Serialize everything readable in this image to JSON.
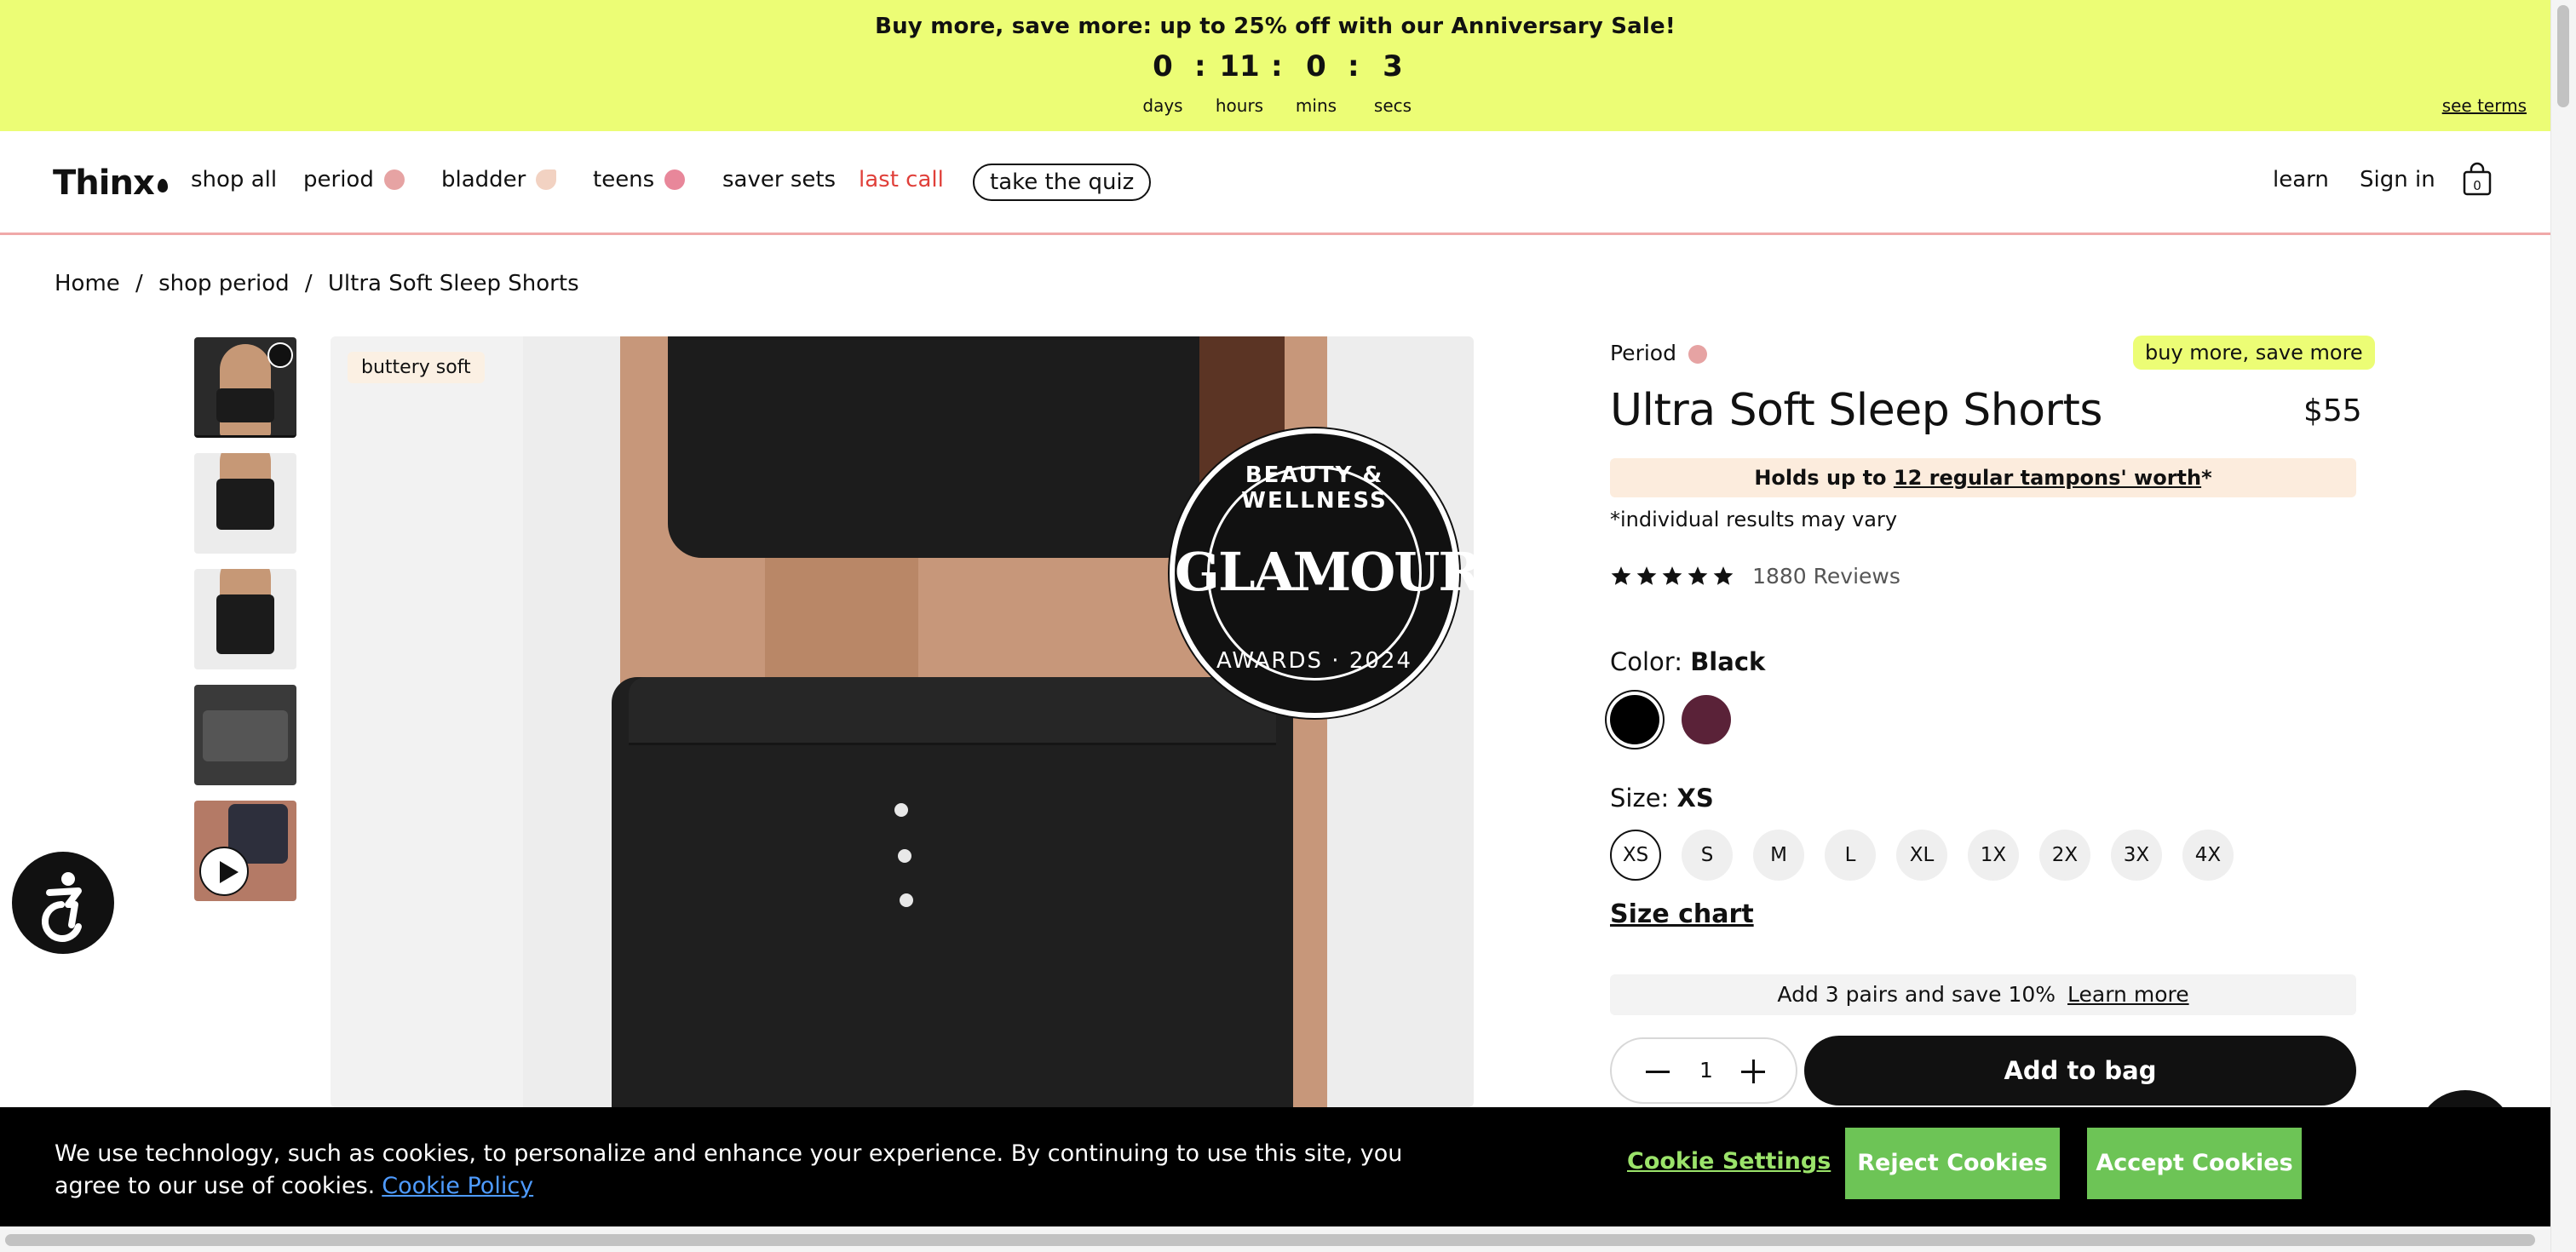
{
  "promo": {
    "text": "Buy more, save more: up to 25% off with our  Anniversary Sale!",
    "countdown": [
      {
        "value": "0",
        "label": "days"
      },
      {
        "value": "11",
        "label": "hours"
      },
      {
        "value": "0",
        "label": "mins"
      },
      {
        "value": "3",
        "label": "secs"
      }
    ],
    "separator": ":",
    "see_terms": "see terms"
  },
  "header": {
    "logo": "Thinx",
    "nav": [
      {
        "label": "shop all"
      },
      {
        "label": "period",
        "dot_color": "#e6a3a3"
      },
      {
        "label": "bladder",
        "dot_color": "#f2d2c2"
      },
      {
        "label": "teens",
        "dot_color": "#e8879a"
      },
      {
        "label": "saver sets"
      },
      {
        "label": "last call",
        "color": "#e0403a"
      }
    ],
    "quiz": "take the quiz",
    "learn": "learn",
    "sign_in": "Sign in",
    "cart_count": "0"
  },
  "breadcrumb": [
    "Home",
    "/",
    "shop period",
    "/",
    "Ultra Soft Sleep Shorts"
  ],
  "gallery": {
    "tag": "buttery soft",
    "badge": {
      "top": "BEAUTY & WELLNESS",
      "main": "GLAMOUR",
      "bottom": "AWARDS · 2024"
    }
  },
  "product": {
    "category": "Period",
    "promo_tag": "buy more, save more",
    "title": "Ultra Soft Sleep Shorts",
    "price": "$55",
    "holds_prefix": "Holds up to ",
    "holds_link": "12 regular tampons' worth",
    "holds_suffix": "*",
    "disclaimer": "*individual results may vary",
    "rating": 5,
    "reviews": "1880 Reviews",
    "color_label": "Color:",
    "color_value": "Black",
    "colors": [
      "#000000",
      "#5a2238"
    ],
    "size_label": "Size:",
    "size_value": "XS",
    "sizes": [
      "XS",
      "S",
      "M",
      "L",
      "XL",
      "1X",
      "2X",
      "3X",
      "4X"
    ],
    "size_chart": "Size chart",
    "bundle_text": "Add 3 pairs and save 10%",
    "bundle_link": "Learn more",
    "quantity": "1",
    "add_to_bag": "Add to bag"
  },
  "cookie": {
    "text": "We use technology, such as cookies, to personalize and enhance your experience. By continuing to use this site, you agree to our use of cookies.",
    "policy": "Cookie Policy",
    "settings": "Cookie Settings",
    "reject": "Reject Cookies",
    "accept": "Accept Cookies"
  },
  "colors": {
    "promo_bg": "#ecfd75",
    "accent_green": "#6dc456",
    "link_blue": "#4e9bff"
  }
}
